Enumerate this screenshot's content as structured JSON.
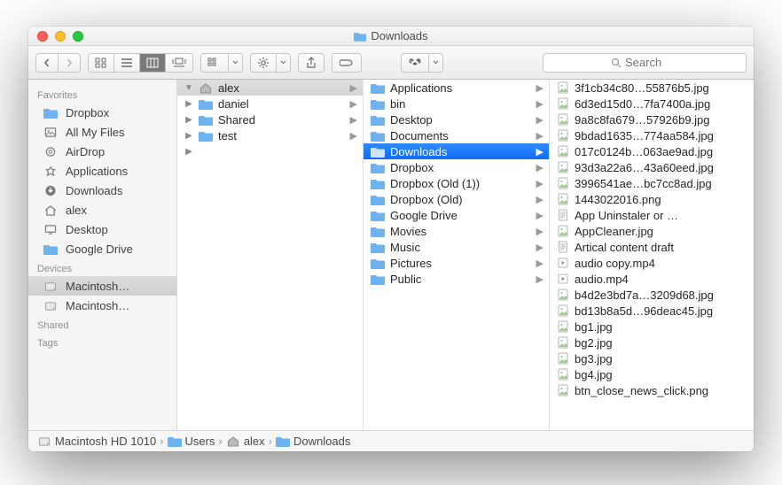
{
  "window": {
    "title": "Downloads"
  },
  "search": {
    "placeholder": "Search"
  },
  "sidebar": {
    "sections": [
      {
        "title": "Favorites",
        "items": [
          {
            "icon": "folder",
            "label": "Dropbox"
          },
          {
            "icon": "allfiles",
            "label": "All My Files"
          },
          {
            "icon": "airdrop",
            "label": "AirDrop"
          },
          {
            "icon": "apps",
            "label": "Applications"
          },
          {
            "icon": "downloads",
            "label": "Downloads"
          },
          {
            "icon": "home",
            "label": "alex"
          },
          {
            "icon": "desktop",
            "label": "Desktop"
          },
          {
            "icon": "folder",
            "label": "Google Drive"
          }
        ]
      },
      {
        "title": "Devices",
        "items": [
          {
            "icon": "disk",
            "label": "Macintosh…",
            "selected": true
          },
          {
            "icon": "disk",
            "label": "Macintosh…"
          }
        ]
      },
      {
        "title": "Shared",
        "items": []
      },
      {
        "title": "Tags",
        "items": []
      }
    ]
  },
  "col0": {
    "items": [
      {
        "disclosed": true,
        "icon": "home",
        "label": "alex",
        "chev": true,
        "selected": true
      },
      {
        "disclosed": false,
        "icon": "folder",
        "label": "daniel",
        "chev": true
      },
      {
        "disclosed": false,
        "icon": "folder",
        "label": "Shared",
        "chev": true
      },
      {
        "disclosed": false,
        "icon": "folder",
        "label": "test",
        "chev": true
      }
    ],
    "trailing_chev": true
  },
  "col1": {
    "items": [
      {
        "icon": "folder",
        "label": "Applications",
        "chev": true
      },
      {
        "icon": "folder",
        "label": "bin",
        "chev": true
      },
      {
        "icon": "folder",
        "label": "Desktop",
        "chev": true
      },
      {
        "icon": "folder",
        "label": "Documents",
        "chev": true
      },
      {
        "icon": "folder",
        "label": "Downloads",
        "chev": true,
        "selected": true
      },
      {
        "icon": "folder",
        "label": "Dropbox",
        "chev": true
      },
      {
        "icon": "folder",
        "label": "Dropbox (Old (1))",
        "chev": true
      },
      {
        "icon": "folder",
        "label": "Dropbox (Old)",
        "chev": true
      },
      {
        "icon": "folder",
        "label": "Google Drive",
        "chev": true
      },
      {
        "icon": "folder",
        "label": "Movies",
        "chev": true
      },
      {
        "icon": "folder",
        "label": "Music",
        "chev": true
      },
      {
        "icon": "folder",
        "label": "Pictures",
        "chev": true
      },
      {
        "icon": "folder",
        "label": "Public",
        "chev": true
      }
    ]
  },
  "col2": {
    "items": [
      {
        "icon": "jpg",
        "label": "3f1cb34c80…55876b5.jpg"
      },
      {
        "icon": "jpg",
        "label": "6d3ed15d0…7fa7400a.jpg"
      },
      {
        "icon": "jpg",
        "label": "9a8c8fa679…57926b9.jpg"
      },
      {
        "icon": "jpg",
        "label": "9bdad1635…774aa584.jpg"
      },
      {
        "icon": "jpg",
        "label": "017c0124b…063ae9ad.jpg"
      },
      {
        "icon": "jpg",
        "label": "93d3a22a6…43a60eed.jpg"
      },
      {
        "icon": "jpg",
        "label": "3996541ae…bc7cc8ad.jpg"
      },
      {
        "icon": "png",
        "label": "1443022016.png"
      },
      {
        "icon": "doc",
        "label": "App Uninstaler or …"
      },
      {
        "icon": "jpg",
        "label": "AppCleaner.jpg"
      },
      {
        "icon": "doc",
        "label": "Artical content draft"
      },
      {
        "icon": "mov",
        "label": "audio copy.mp4"
      },
      {
        "icon": "mov",
        "label": "audio.mp4"
      },
      {
        "icon": "jpg",
        "label": "b4d2e3bd7a…3209d68.jpg"
      },
      {
        "icon": "jpg",
        "label": "bd13b8a5d…96deac45.jpg"
      },
      {
        "icon": "jpg",
        "label": "bg1.jpg"
      },
      {
        "icon": "jpg",
        "label": "bg2.jpg"
      },
      {
        "icon": "jpg",
        "label": "bg3.jpg"
      },
      {
        "icon": "jpg",
        "label": "bg4.jpg"
      },
      {
        "icon": "png",
        "label": "btn_close_news_click.png"
      }
    ]
  },
  "pathbar": [
    {
      "icon": "disk",
      "label": "Macintosh HD 1010"
    },
    {
      "icon": "folder",
      "label": "Users"
    },
    {
      "icon": "home",
      "label": "alex"
    },
    {
      "icon": "folder",
      "label": "Downloads"
    }
  ]
}
